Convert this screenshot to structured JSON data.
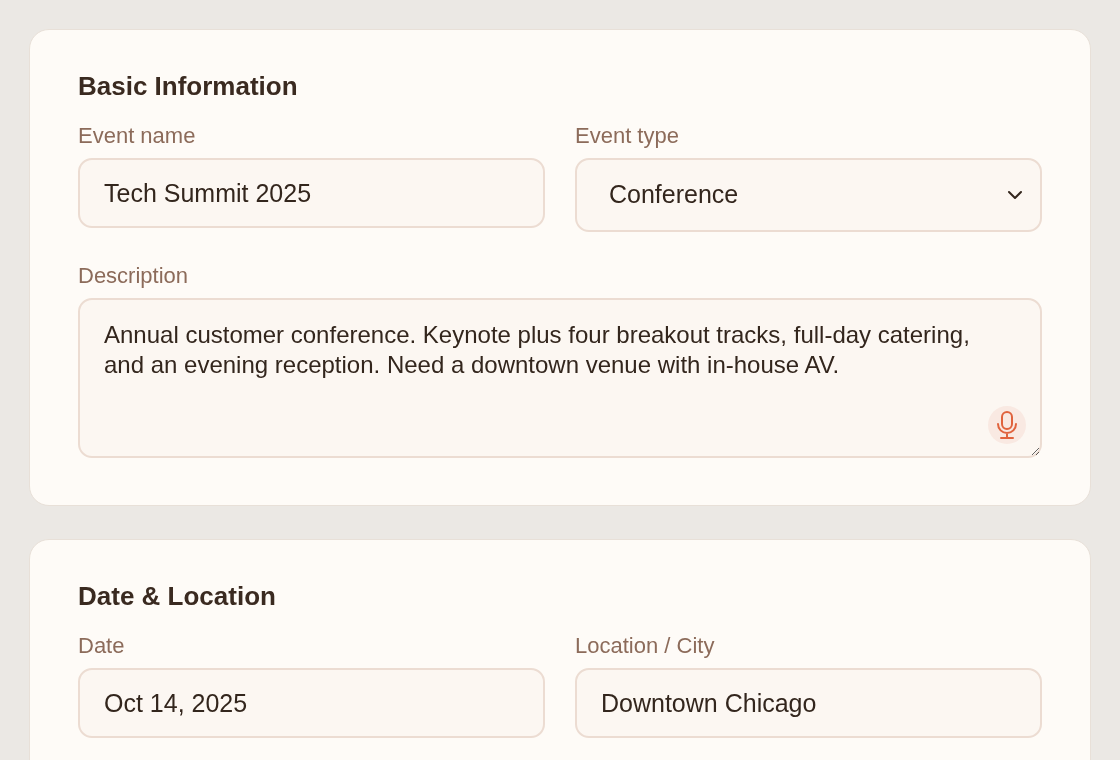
{
  "sections": [
    {
      "title": "Basic Information",
      "rows": [
        [
          {
            "kind": "text",
            "label": "Event name",
            "value": "Tech Summit 2025"
          },
          {
            "kind": "select",
            "label": "Event type",
            "value": "Conference"
          }
        ],
        [
          {
            "kind": "textarea",
            "label": "Description",
            "value": "Annual customer conference. Keynote plus four breakout tracks, full-day catering, and an evening reception. Need a downtown venue with in-house AV.",
            "voice_input": true
          }
        ]
      ]
    },
    {
      "title": "Date & Location",
      "rows": [
        [
          {
            "kind": "text",
            "label": "Date",
            "value": "Oct 14, 2025"
          },
          {
            "kind": "text",
            "label": "Location / City",
            "value": "Downtown Chicago"
          }
        ]
      ]
    }
  ]
}
